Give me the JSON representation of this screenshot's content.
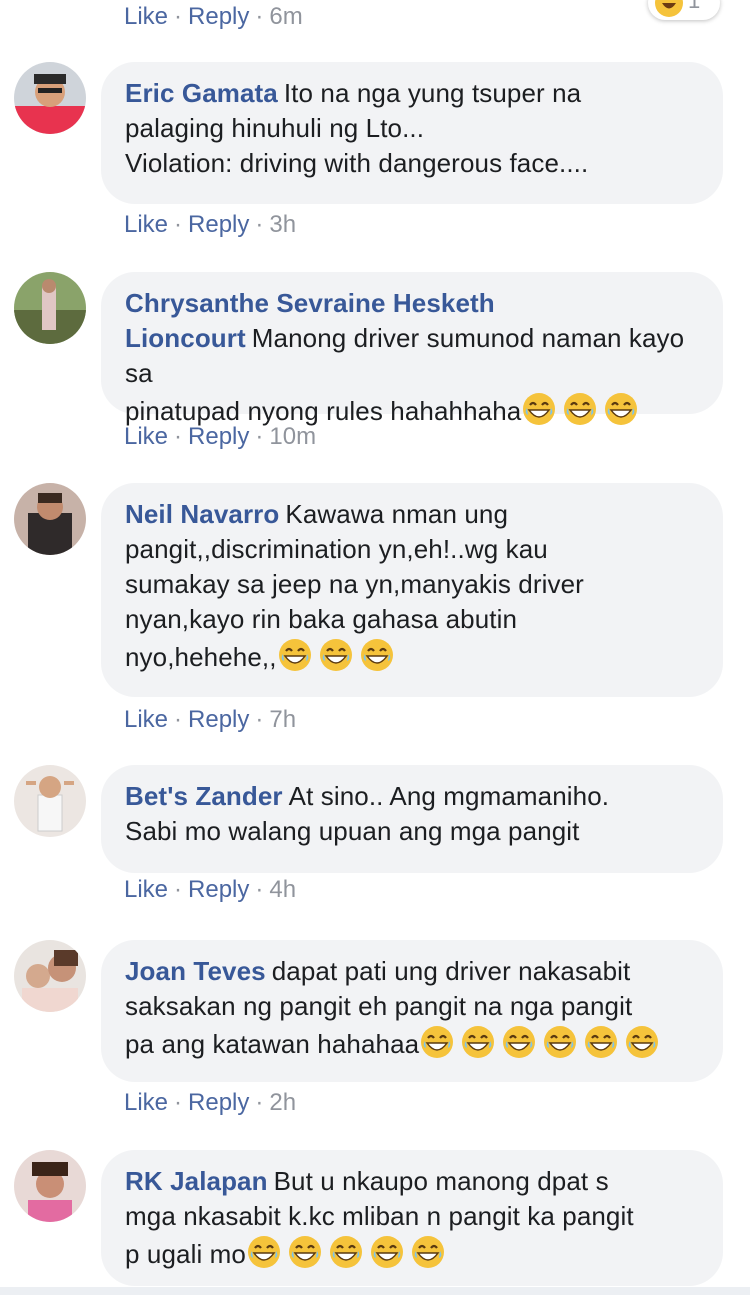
{
  "top_actions": {
    "like": "Like",
    "reply": "Reply",
    "time": "6m"
  },
  "top_reaction": {
    "icon": "haha-reaction-icon",
    "count": "1"
  },
  "comments": [
    {
      "author": "Eric Gamata",
      "text": "Ito na nga yung tsuper na\npalaging hinuhuli ng Lto...\nViolation: driving with dangerous face....",
      "like": "Like",
      "reply": "Reply",
      "time": "3h",
      "emoji_count": 0,
      "avatar": "avatar-photo"
    },
    {
      "author": "Chrysanthe Sevraine Hesketh Lioncourt",
      "text": "Manong driver sumunod naman kayo sa\npinatupad nyong rules hahahhaha",
      "like": "Like",
      "reply": "Reply",
      "time": "10m",
      "emoji_count": 3,
      "avatar": "avatar-photo"
    },
    {
      "author": "Neil Navarro",
      "text": "Kawawa nman ung\npangit,,discrimination yn,eh!..wg kau\nsumakay sa jeep na yn,manyakis driver\nnyan,kayo rin baka gahasa abutin\nnyo,hehehe,,",
      "like": "Like",
      "reply": "Reply",
      "time": "7h",
      "emoji_count": 3,
      "avatar": "avatar-photo"
    },
    {
      "author": "Bet's Zander",
      "text": "At sino.. Ang mgmamaniho.\nSabi mo walang upuan ang mga pangit",
      "like": "Like",
      "reply": "Reply",
      "time": "4h",
      "emoji_count": 0,
      "avatar": "avatar-photo"
    },
    {
      "author": "Joan Teves",
      "text": "dapat pati ung driver nakasabit\nsaksakan ng pangit eh pangit na nga pangit\npa ang katawan hahahaa",
      "like": "Like",
      "reply": "Reply",
      "time": "2h",
      "emoji_count": 6,
      "avatar": "avatar-photo"
    },
    {
      "author": "RK Jalapan",
      "text": "But u nkaupo manong dpat s\nmga nkasabit k.kc mliban n pangit ka pangit\np ugali mo",
      "like": "Like",
      "reply": "Reply",
      "time": "",
      "emoji_count": 5,
      "avatar": "avatar-photo"
    }
  ],
  "colors": {
    "author": "#385898",
    "link": "#4b67a1",
    "meta": "#90949c",
    "bubble": "#f2f3f5",
    "emoji": "#f5c33b"
  }
}
